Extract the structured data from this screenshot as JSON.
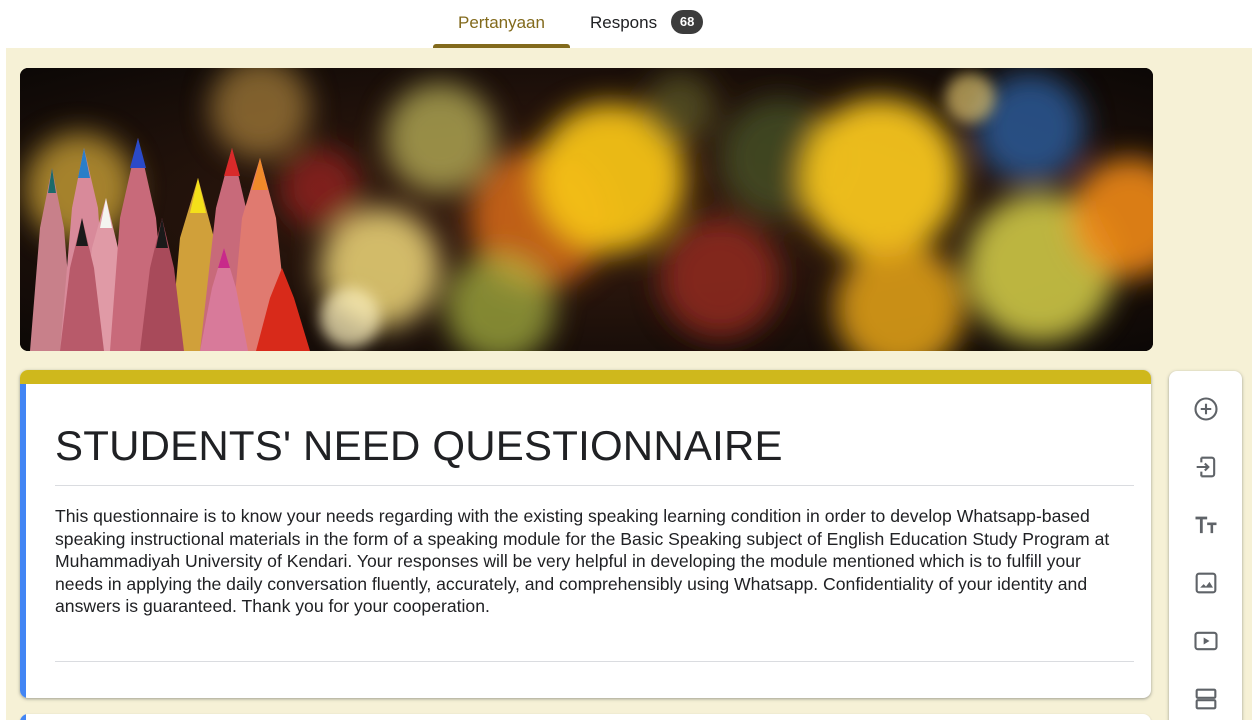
{
  "tabs": {
    "questions_label": "Pertanyaan",
    "responses_label": "Respons",
    "responses_count": "68"
  },
  "form": {
    "title": "STUDENTS' NEED QUESTIONNAIRE",
    "description": "This questionnaire is to know your needs regarding with the existing speaking learning condition in order to develop Whatsapp-based speaking instructional materials in the form of a speaking module for the Basic Speaking subject of English Education Study Program at Muhammadiyah University of Kendari.  Your responses will be very helpful in developing the  module mentioned which is to fulfill your needs in applying the daily conversation fluently, accurately, and comprehensibly using Whatsapp. Confidentiality of your identity and answers is guaranteed. Thank you for your cooperation."
  },
  "toolbar": {
    "icons": [
      "add-question-icon",
      "import-questions-icon",
      "add-title-icon",
      "add-image-icon",
      "add-video-icon",
      "add-section-icon"
    ]
  },
  "colors": {
    "theme_accent": "#826a1c",
    "card_header": "#cfb81c",
    "canvas_bg": "#f6f1d6",
    "focus_bar": "#4285f4",
    "badge_bg": "#3c3c3c"
  }
}
